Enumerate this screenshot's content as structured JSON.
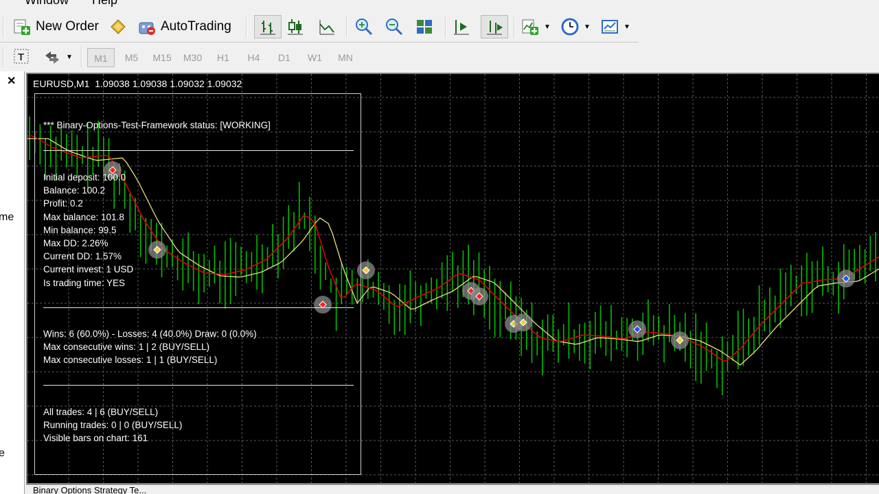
{
  "menu": {
    "window": "Window",
    "help": "Help"
  },
  "toolbar": {
    "new_order": "New Order",
    "auto_trading": "AutoTrading"
  },
  "timeframes": [
    "M1",
    "M5",
    "M15",
    "M30",
    "H1",
    "H4",
    "D1",
    "W1",
    "MN"
  ],
  "active_timeframe": "M1",
  "navigator": {
    "text1": "me",
    "text2": "e"
  },
  "chart": {
    "header": "EURUSD,M1  1.09038 1.09038 1.09032 1.09032",
    "background": "#000000",
    "grid_color": "#5a5a5a",
    "bull_color": "#00c000",
    "fast_ma_color": "#e00000",
    "slow_ma_color": "#e8e080"
  },
  "panel": {
    "status": "*** Binary-Options-Test-Framework status: [WORKING]",
    "stats": [
      "Initial deposit: 100.0",
      "Balance: 100.2",
      "Profit: 0.2",
      "Max balance: 101.8",
      "Min balance: 99.5",
      "Max DD: 2.26%",
      "Current DD: 1.57%",
      "Current invest: 1 USD",
      "Is trading time: YES"
    ],
    "results": [
      "Wins: 6 (60.0%) - Losses: 4 (40.0%) Draw: 0 (0.0%)",
      "Max consecutive wins: 1 | 2 (BUY/SELL)",
      "Max consecutive losses: 1 | 1 (BUY/SELL)"
    ],
    "trades": [
      "All trades: 4 | 6 (BUY/SELL)",
      "Running trades: 0 | 0 (BUY/SELL)",
      "Visible bars on chart: 161"
    ]
  },
  "bottom_tab": "Binary Options Strategy Te..."
}
